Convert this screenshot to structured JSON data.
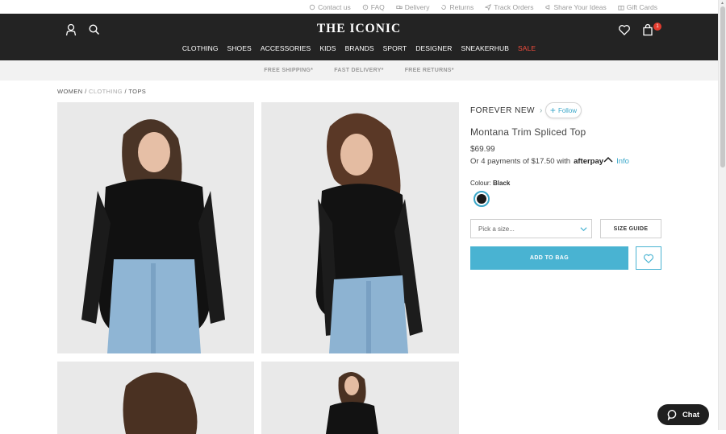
{
  "utility_links": [
    "Contact us",
    "FAQ",
    "Delivery",
    "Returns",
    "Track Orders",
    "Share Your Ideas",
    "Gift Cards"
  ],
  "header": {
    "logo": "THE ICONIC",
    "bag_count": "1"
  },
  "nav": [
    "CLOTHING",
    "SHOES",
    "ACCESSORIES",
    "KIDS",
    "BRANDS",
    "SPORT",
    "DESIGNER",
    "SNEAKERHUB",
    "SALE"
  ],
  "promo": [
    "FREE SHIPPING*",
    "FAST DELIVERY*",
    "FREE RETURNS*"
  ],
  "breadcrumb": {
    "women": "WOMEN",
    "sep1": " / ",
    "clothing": "CLOTHING",
    "sep2": " / ",
    "tops": "TOPS"
  },
  "product": {
    "brand": "FOREVER NEW",
    "follow_label": "Follow",
    "name": "Montana Trim Spliced Top",
    "price": "$69.99",
    "afterpay_text": "Or 4 payments of $17.50 with",
    "afterpay_brand": "afterpay",
    "afterpay_info": "Info",
    "colour_label": "Colour:",
    "colour_value": "Black",
    "size_placeholder": "Pick a size...",
    "size_guide": "SIZE GUIDE",
    "add_to_bag": "ADD TO BAG"
  },
  "chat_label": "Chat",
  "colors": {
    "header_bg": "#232323",
    "accent": "#49b3d2",
    "sale": "#f04c3c",
    "swatch_black": "#1a1a1a"
  }
}
